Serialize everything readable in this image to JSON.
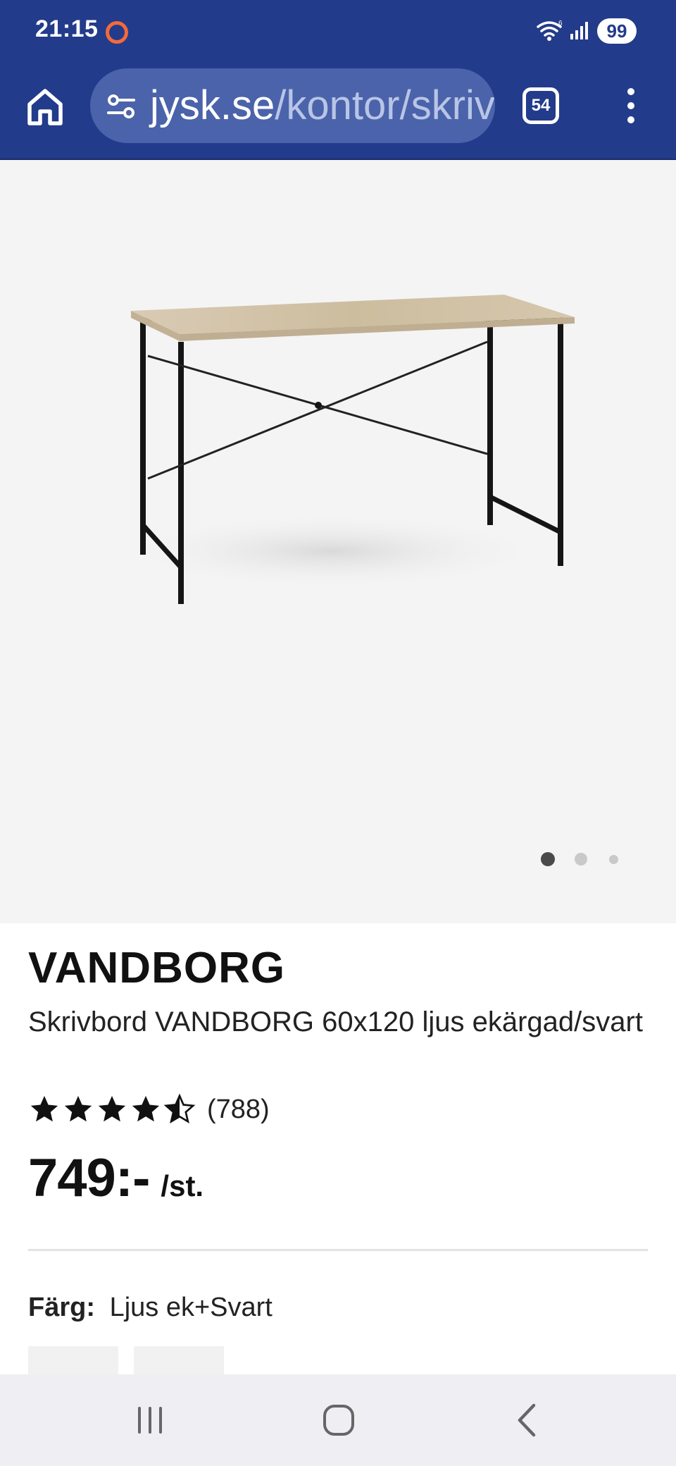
{
  "status_bar": {
    "time": "21:15",
    "battery": "99"
  },
  "browser": {
    "url_domain": "jysk.se",
    "url_path": "/kontor/skrivbord",
    "tab_count": "54"
  },
  "gallery": {
    "image_count": 3,
    "active_index": 0
  },
  "product": {
    "brand": "VANDBORG",
    "description": "Skrivbord VANDBORG 60x120 ljus ekärgad/svart",
    "rating": 4.5,
    "rating_count": "(788)",
    "price": "749:-",
    "price_unit": "/st.",
    "color_label": "Färg:",
    "color_value": "Ljus ek+Svart"
  },
  "colors": {
    "brand_blue": "#233b8b",
    "url_pill": "#4b63aa",
    "accent_orange": "#f26a3c"
  }
}
